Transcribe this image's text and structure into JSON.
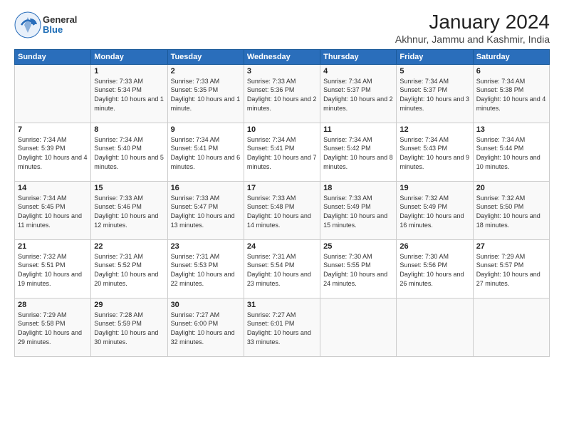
{
  "logo": {
    "general": "General",
    "blue": "Blue"
  },
  "title": "January 2024",
  "subtitle": "Akhnur, Jammu and Kashmir, India",
  "headers": [
    "Sunday",
    "Monday",
    "Tuesday",
    "Wednesday",
    "Thursday",
    "Friday",
    "Saturday"
  ],
  "weeks": [
    [
      {
        "num": "",
        "sunrise": "",
        "sunset": "",
        "daylight": ""
      },
      {
        "num": "1",
        "sunrise": "Sunrise: 7:33 AM",
        "sunset": "Sunset: 5:34 PM",
        "daylight": "Daylight: 10 hours and 1 minute."
      },
      {
        "num": "2",
        "sunrise": "Sunrise: 7:33 AM",
        "sunset": "Sunset: 5:35 PM",
        "daylight": "Daylight: 10 hours and 1 minute."
      },
      {
        "num": "3",
        "sunrise": "Sunrise: 7:33 AM",
        "sunset": "Sunset: 5:36 PM",
        "daylight": "Daylight: 10 hours and 2 minutes."
      },
      {
        "num": "4",
        "sunrise": "Sunrise: 7:34 AM",
        "sunset": "Sunset: 5:37 PM",
        "daylight": "Daylight: 10 hours and 2 minutes."
      },
      {
        "num": "5",
        "sunrise": "Sunrise: 7:34 AM",
        "sunset": "Sunset: 5:37 PM",
        "daylight": "Daylight: 10 hours and 3 minutes."
      },
      {
        "num": "6",
        "sunrise": "Sunrise: 7:34 AM",
        "sunset": "Sunset: 5:38 PM",
        "daylight": "Daylight: 10 hours and 4 minutes."
      }
    ],
    [
      {
        "num": "7",
        "sunrise": "Sunrise: 7:34 AM",
        "sunset": "Sunset: 5:39 PM",
        "daylight": "Daylight: 10 hours and 4 minutes."
      },
      {
        "num": "8",
        "sunrise": "Sunrise: 7:34 AM",
        "sunset": "Sunset: 5:40 PM",
        "daylight": "Daylight: 10 hours and 5 minutes."
      },
      {
        "num": "9",
        "sunrise": "Sunrise: 7:34 AM",
        "sunset": "Sunset: 5:41 PM",
        "daylight": "Daylight: 10 hours and 6 minutes."
      },
      {
        "num": "10",
        "sunrise": "Sunrise: 7:34 AM",
        "sunset": "Sunset: 5:41 PM",
        "daylight": "Daylight: 10 hours and 7 minutes."
      },
      {
        "num": "11",
        "sunrise": "Sunrise: 7:34 AM",
        "sunset": "Sunset: 5:42 PM",
        "daylight": "Daylight: 10 hours and 8 minutes."
      },
      {
        "num": "12",
        "sunrise": "Sunrise: 7:34 AM",
        "sunset": "Sunset: 5:43 PM",
        "daylight": "Daylight: 10 hours and 9 minutes."
      },
      {
        "num": "13",
        "sunrise": "Sunrise: 7:34 AM",
        "sunset": "Sunset: 5:44 PM",
        "daylight": "Daylight: 10 hours and 10 minutes."
      }
    ],
    [
      {
        "num": "14",
        "sunrise": "Sunrise: 7:34 AM",
        "sunset": "Sunset: 5:45 PM",
        "daylight": "Daylight: 10 hours and 11 minutes."
      },
      {
        "num": "15",
        "sunrise": "Sunrise: 7:33 AM",
        "sunset": "Sunset: 5:46 PM",
        "daylight": "Daylight: 10 hours and 12 minutes."
      },
      {
        "num": "16",
        "sunrise": "Sunrise: 7:33 AM",
        "sunset": "Sunset: 5:47 PM",
        "daylight": "Daylight: 10 hours and 13 minutes."
      },
      {
        "num": "17",
        "sunrise": "Sunrise: 7:33 AM",
        "sunset": "Sunset: 5:48 PM",
        "daylight": "Daylight: 10 hours and 14 minutes."
      },
      {
        "num": "18",
        "sunrise": "Sunrise: 7:33 AM",
        "sunset": "Sunset: 5:49 PM",
        "daylight": "Daylight: 10 hours and 15 minutes."
      },
      {
        "num": "19",
        "sunrise": "Sunrise: 7:32 AM",
        "sunset": "Sunset: 5:49 PM",
        "daylight": "Daylight: 10 hours and 16 minutes."
      },
      {
        "num": "20",
        "sunrise": "Sunrise: 7:32 AM",
        "sunset": "Sunset: 5:50 PM",
        "daylight": "Daylight: 10 hours and 18 minutes."
      }
    ],
    [
      {
        "num": "21",
        "sunrise": "Sunrise: 7:32 AM",
        "sunset": "Sunset: 5:51 PM",
        "daylight": "Daylight: 10 hours and 19 minutes."
      },
      {
        "num": "22",
        "sunrise": "Sunrise: 7:31 AM",
        "sunset": "Sunset: 5:52 PM",
        "daylight": "Daylight: 10 hours and 20 minutes."
      },
      {
        "num": "23",
        "sunrise": "Sunrise: 7:31 AM",
        "sunset": "Sunset: 5:53 PM",
        "daylight": "Daylight: 10 hours and 22 minutes."
      },
      {
        "num": "24",
        "sunrise": "Sunrise: 7:31 AM",
        "sunset": "Sunset: 5:54 PM",
        "daylight": "Daylight: 10 hours and 23 minutes."
      },
      {
        "num": "25",
        "sunrise": "Sunrise: 7:30 AM",
        "sunset": "Sunset: 5:55 PM",
        "daylight": "Daylight: 10 hours and 24 minutes."
      },
      {
        "num": "26",
        "sunrise": "Sunrise: 7:30 AM",
        "sunset": "Sunset: 5:56 PM",
        "daylight": "Daylight: 10 hours and 26 minutes."
      },
      {
        "num": "27",
        "sunrise": "Sunrise: 7:29 AM",
        "sunset": "Sunset: 5:57 PM",
        "daylight": "Daylight: 10 hours and 27 minutes."
      }
    ],
    [
      {
        "num": "28",
        "sunrise": "Sunrise: 7:29 AM",
        "sunset": "Sunset: 5:58 PM",
        "daylight": "Daylight: 10 hours and 29 minutes."
      },
      {
        "num": "29",
        "sunrise": "Sunrise: 7:28 AM",
        "sunset": "Sunset: 5:59 PM",
        "daylight": "Daylight: 10 hours and 30 minutes."
      },
      {
        "num": "30",
        "sunrise": "Sunrise: 7:27 AM",
        "sunset": "Sunset: 6:00 PM",
        "daylight": "Daylight: 10 hours and 32 minutes."
      },
      {
        "num": "31",
        "sunrise": "Sunrise: 7:27 AM",
        "sunset": "Sunset: 6:01 PM",
        "daylight": "Daylight: 10 hours and 33 minutes."
      },
      {
        "num": "",
        "sunrise": "",
        "sunset": "",
        "daylight": ""
      },
      {
        "num": "",
        "sunrise": "",
        "sunset": "",
        "daylight": ""
      },
      {
        "num": "",
        "sunrise": "",
        "sunset": "",
        "daylight": ""
      }
    ]
  ]
}
